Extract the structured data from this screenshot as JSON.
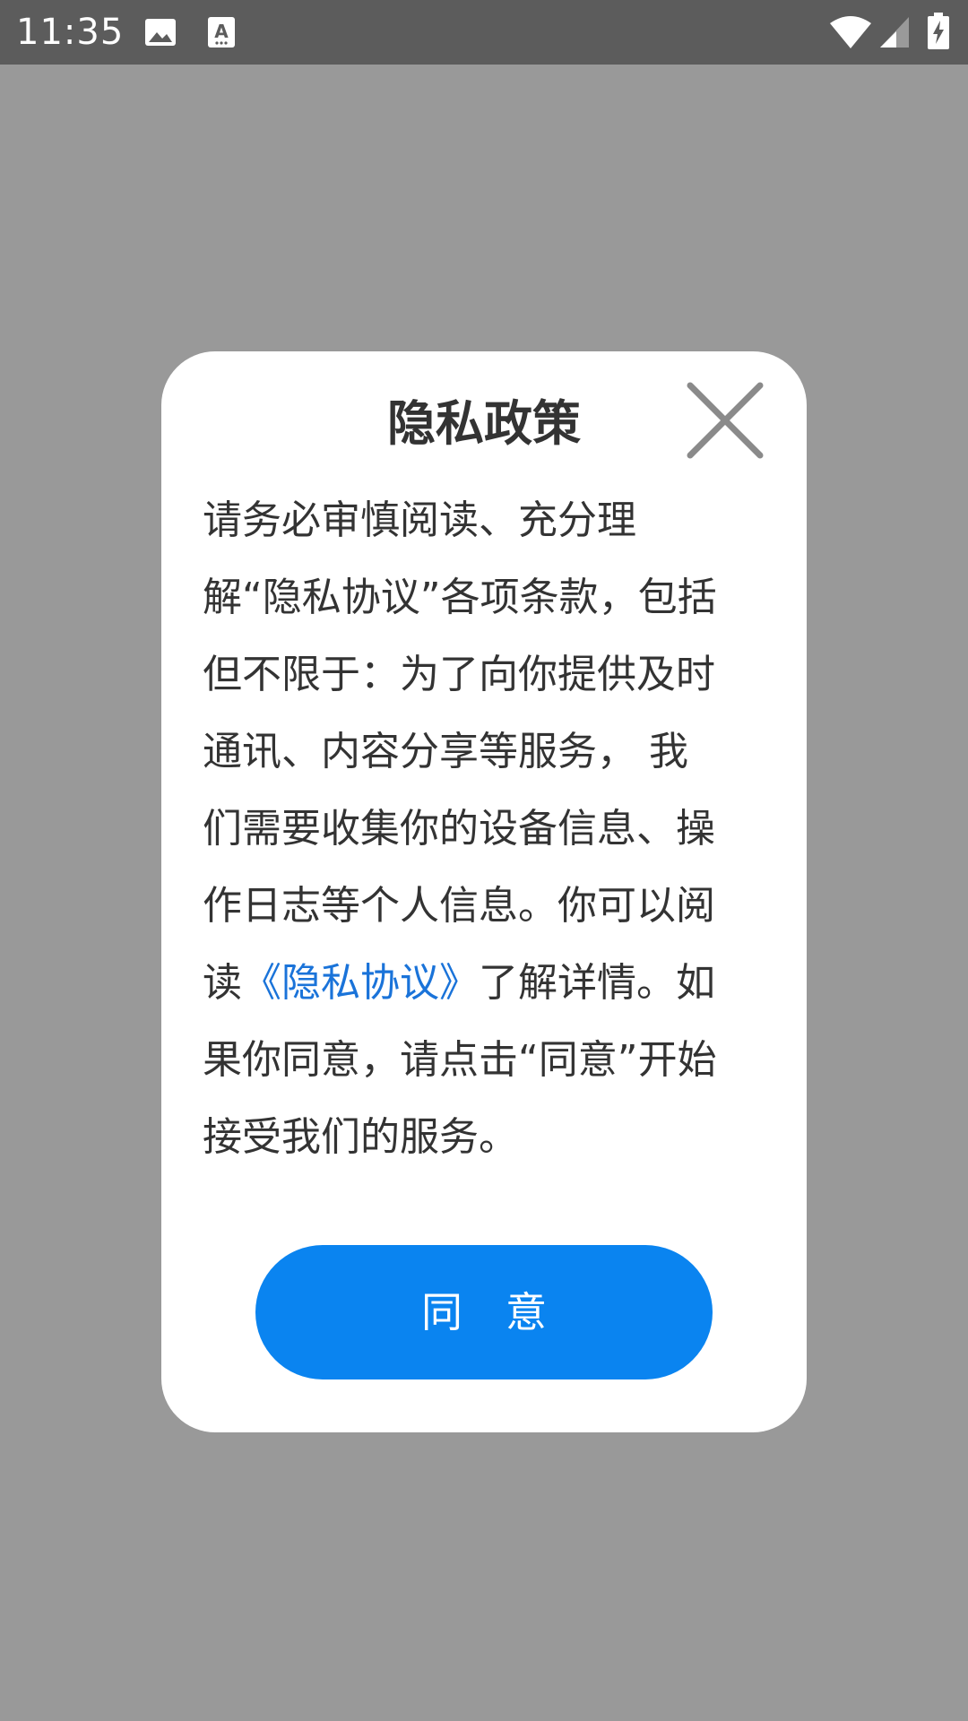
{
  "status_bar": {
    "time": "11:35",
    "icons": [
      "image-icon",
      "text-accessibility-icon",
      "wifi-icon",
      "signal-icon",
      "battery-charging-icon"
    ]
  },
  "dialog": {
    "title": "隐私政策",
    "close_icon": "close-icon",
    "body": {
      "line1": "请务必审慎阅读、充分理",
      "line2": "解“隐私协议”各项条款，包括",
      "line3": "但不限于：为了向你提供及时",
      "line4": "通讯、内容分享等服务， 我",
      "line5": "们需要收集你的设备信息、操",
      "line6": "作日志等个人信息。你可以阅",
      "line7_pre": "读",
      "line7_link": "《隐私协议》",
      "line7_post": "了解详情。如",
      "line8": "果你同意，请点击“同意”开始",
      "line9": "接受我们的服务。"
    },
    "agree_label": "同意"
  },
  "colors": {
    "overlay": "#999999",
    "status_bar": "#5c5c5c",
    "accent": "#0a84f0",
    "link": "#1a73d9"
  }
}
